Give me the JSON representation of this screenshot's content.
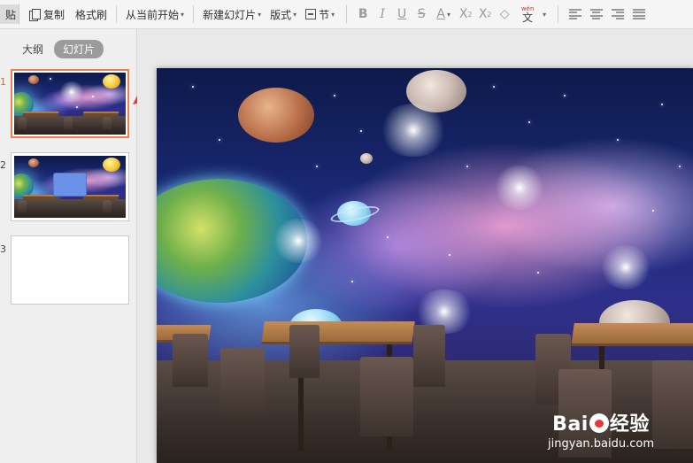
{
  "toolbar": {
    "paste_label": "贴",
    "copy_label": "复制",
    "format_painter_label": "格式刷",
    "play_from_current_label": "从当前开始",
    "new_slide_label": "新建幻灯片",
    "layout_label": "版式",
    "section_label": "节",
    "bold_glyph": "B",
    "italic_glyph": "I",
    "underline_glyph": "U",
    "strike_glyph": "S",
    "font_color_glyph": "A",
    "superscript_glyph": "X",
    "superscript_mark": "2",
    "subscript_glyph": "X",
    "subscript_mark": "2",
    "clear_glyph": "◇",
    "phonetic_glyph": "文",
    "phonetic_mark": "wén",
    "caret": "▾"
  },
  "panel": {
    "tabs": [
      {
        "label": "大纲",
        "active": false
      },
      {
        "label": "幻灯片",
        "active": true
      }
    ],
    "slides": [
      {
        "number": "1",
        "selected": true
      },
      {
        "number": "2",
        "selected": false
      },
      {
        "number": "3",
        "selected": false
      }
    ]
  },
  "watermark": {
    "logo_left": "Bai",
    "logo_right": "经验",
    "url": "jingyan.baidu.com"
  },
  "colors": {
    "accent_selected": "#ef7e50",
    "arrow": "#e53a3a",
    "tab_active_bg": "#9b9b9b"
  },
  "icons": [
    "copy-icon",
    "section-icon",
    "align-left-icon",
    "align-center-icon",
    "align-right-icon",
    "align-justify-icon",
    "eraser-icon",
    "phonetic-icon"
  ]
}
